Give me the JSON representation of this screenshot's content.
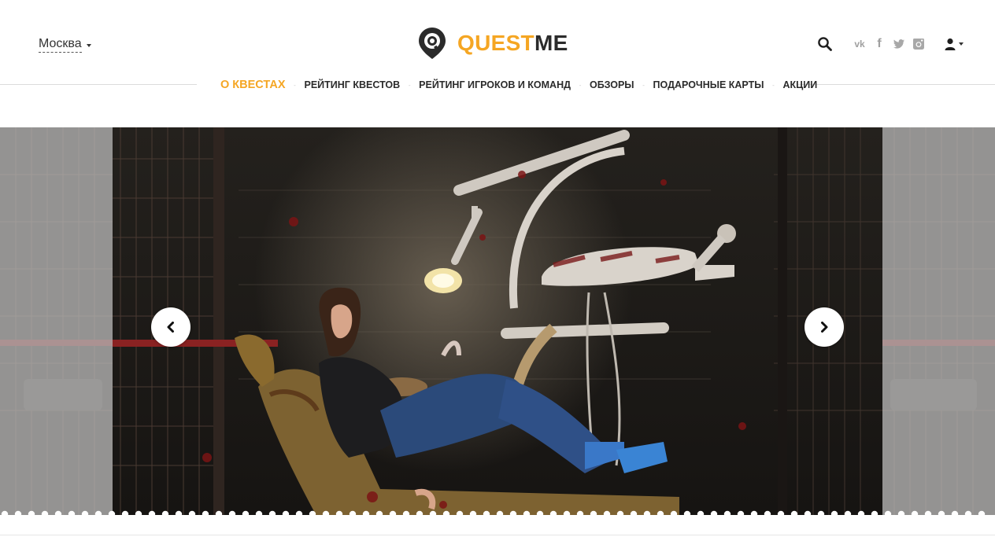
{
  "header": {
    "city": {
      "label": "Москва",
      "caret_icon": "caret-down-icon"
    },
    "logo": {
      "part1": "QUEST",
      "part2": "ME",
      "icon": "map-pin-logo-icon",
      "accent_color": "#f5a623",
      "dark_color": "#2b2b2b"
    },
    "actions": {
      "search_icon": "search-icon",
      "social": [
        "vk-icon",
        "facebook-icon",
        "twitter-icon",
        "instagram-icon"
      ],
      "social_glyphs": {
        "vk": "vk",
        "facebook": "f"
      },
      "user_icon": "user-icon"
    }
  },
  "nav": {
    "items": [
      {
        "label": "О квестах",
        "active": true
      },
      {
        "label": "Рейтинг квестов",
        "active": false
      },
      {
        "label": "Рейтинг игроков и команд",
        "active": false
      },
      {
        "label": "Обзоры",
        "active": false
      },
      {
        "label": "Подарочные карты",
        "active": false
      },
      {
        "label": "Акции",
        "active": false
      }
    ],
    "separator": "-"
  },
  "slider": {
    "prev_icon": "chevron-left-icon",
    "next_icon": "chevron-right-icon",
    "slide_image": "horror-dental-room-photo"
  }
}
